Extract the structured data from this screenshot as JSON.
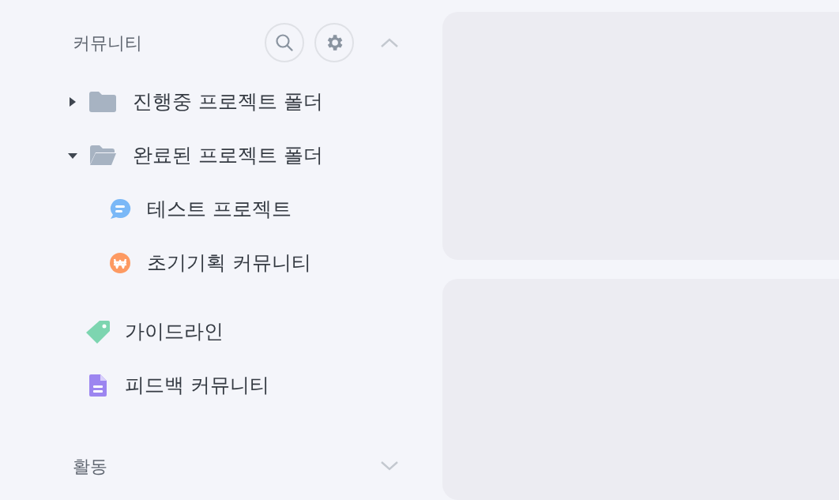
{
  "sections": [
    {
      "title": "커뮤니티",
      "expanded": true,
      "tools": [
        {
          "kind": "search"
        },
        {
          "kind": "settings"
        }
      ],
      "items": [
        {
          "kind": "folder",
          "label": "진행중 프로젝트 폴더",
          "expanded": false
        },
        {
          "kind": "folder",
          "label": "완료된 프로젝트 폴더",
          "expanded": true,
          "children": [
            {
              "kind": "chat",
              "label": "테스트 프로젝트"
            },
            {
              "kind": "won",
              "label": "초기기획 커뮤니티"
            }
          ]
        },
        {
          "kind": "tag",
          "label": "가이드라인"
        },
        {
          "kind": "doc",
          "label": "피드백 커뮤니티"
        }
      ]
    },
    {
      "title": "활동",
      "expanded": false
    }
  ]
}
